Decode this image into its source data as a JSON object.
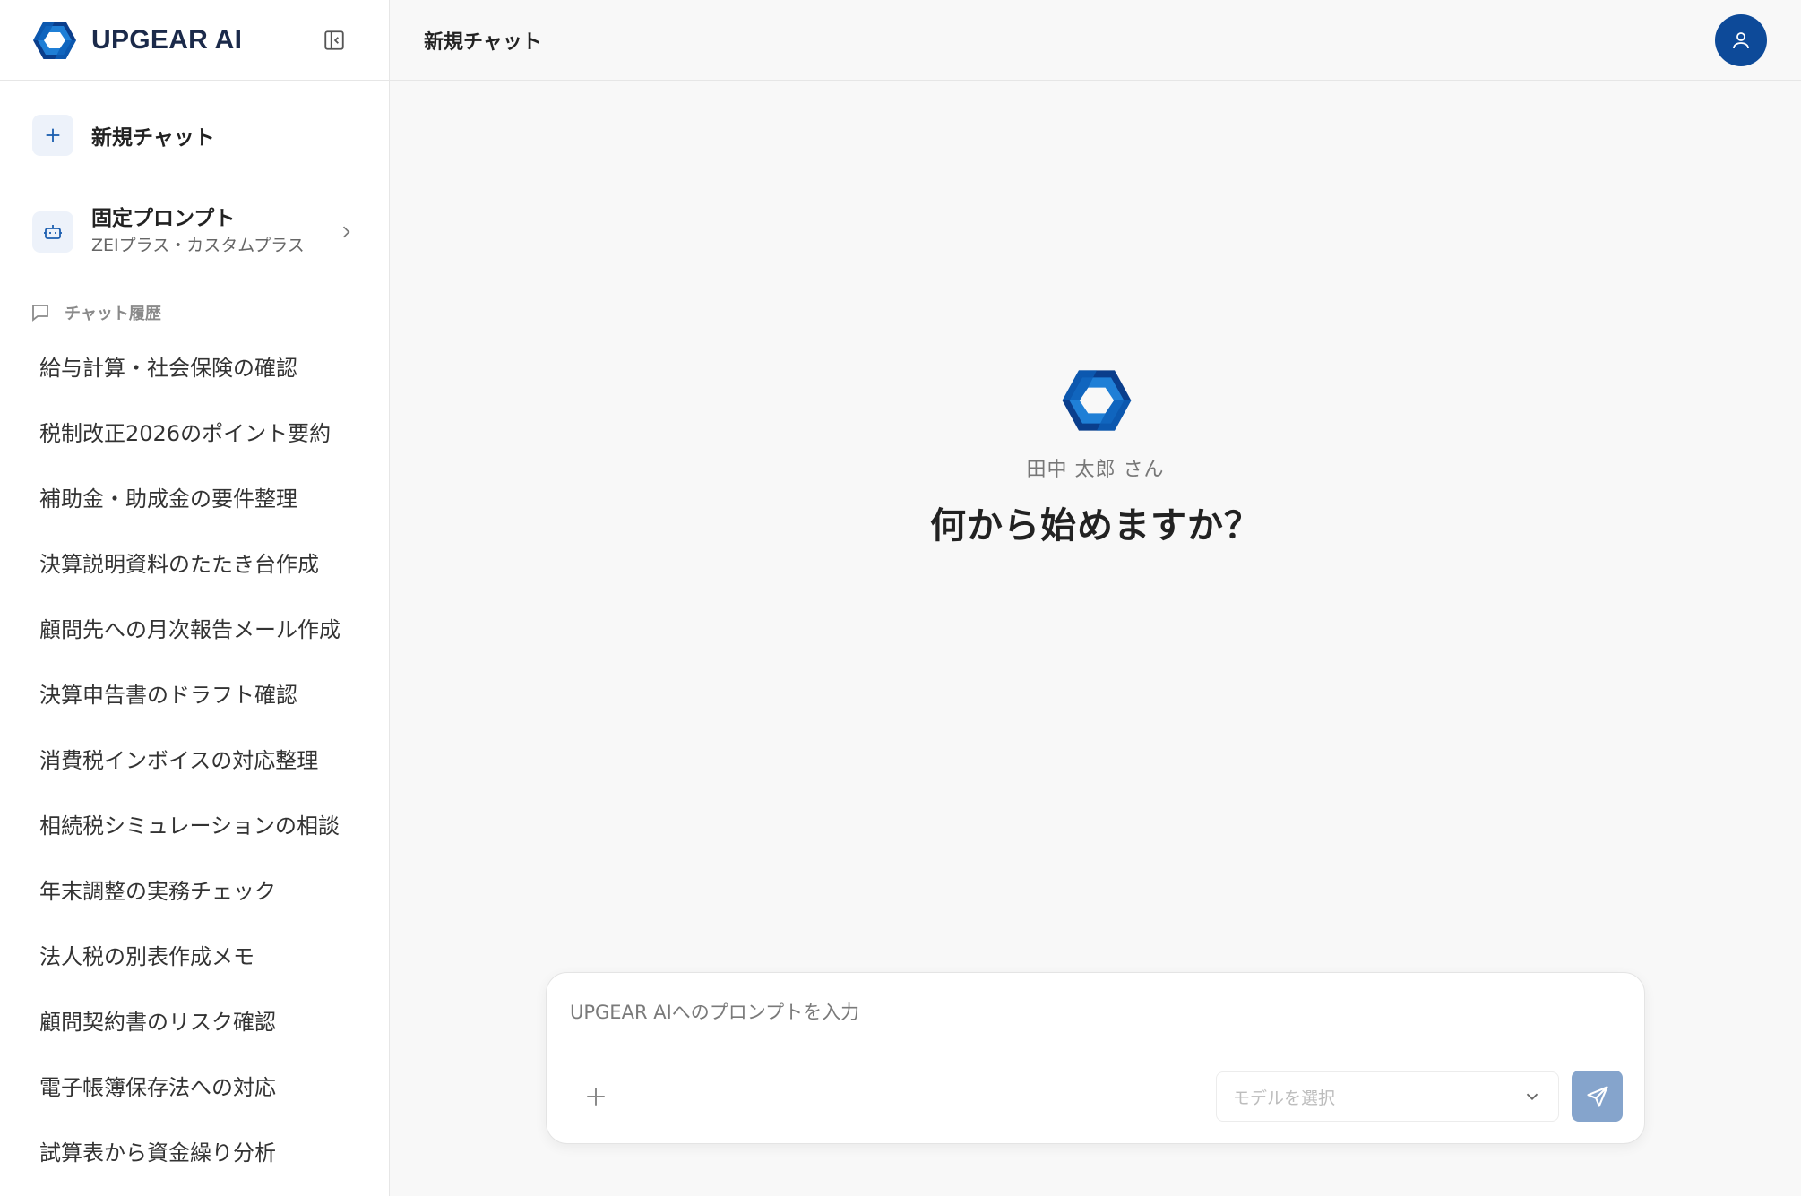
{
  "brand": {
    "name": "UPGEAR AI",
    "logo_colors": [
      "#0a3e8c",
      "#1f7fd6",
      "#5fc8ff"
    ]
  },
  "sidebar": {
    "collapse_icon": "sidebar-collapse-icon",
    "new_chat": {
      "label": "新規チャット",
      "icon": "plus-icon"
    },
    "fixed_prompt": {
      "title": "固定プロンプト",
      "subtitle": "ZEIプラス・カスタムプラス",
      "icon": "robot-icon"
    },
    "history": {
      "title": "チャット履歴",
      "icon": "chat-bubble-icon",
      "items": [
        "給与計算・社会保険の確認",
        "税制改正2026のポイント要約",
        "補助金・助成金の要件整理",
        "決算説明資料のたたき台作成",
        "顧問先への月次報告メール作成",
        "決算申告書のドラフト確認",
        "消費税インボイスの対応整理",
        "相続税シミュレーションの相談",
        "年末調整の実務チェック",
        "法人税の別表作成メモ",
        "顧問契約書のリスク確認",
        "電子帳簿保存法への対応",
        "試算表から資金繰り分析"
      ]
    }
  },
  "header": {
    "title": "新規チャット",
    "avatar_icon": "user-icon",
    "avatar_color": "#0d4a99"
  },
  "welcome": {
    "user_name": "田中 太郎 さん",
    "heading": "何から始めますか？"
  },
  "composer": {
    "placeholder": "UPGEAR AIへのプロンプトを入力",
    "attach_icon": "plus-icon",
    "model_select": {
      "placeholder": "モデルを選択",
      "icon": "chevron-down-icon"
    },
    "send_icon": "send-icon",
    "send_color": "#85a4cc"
  }
}
